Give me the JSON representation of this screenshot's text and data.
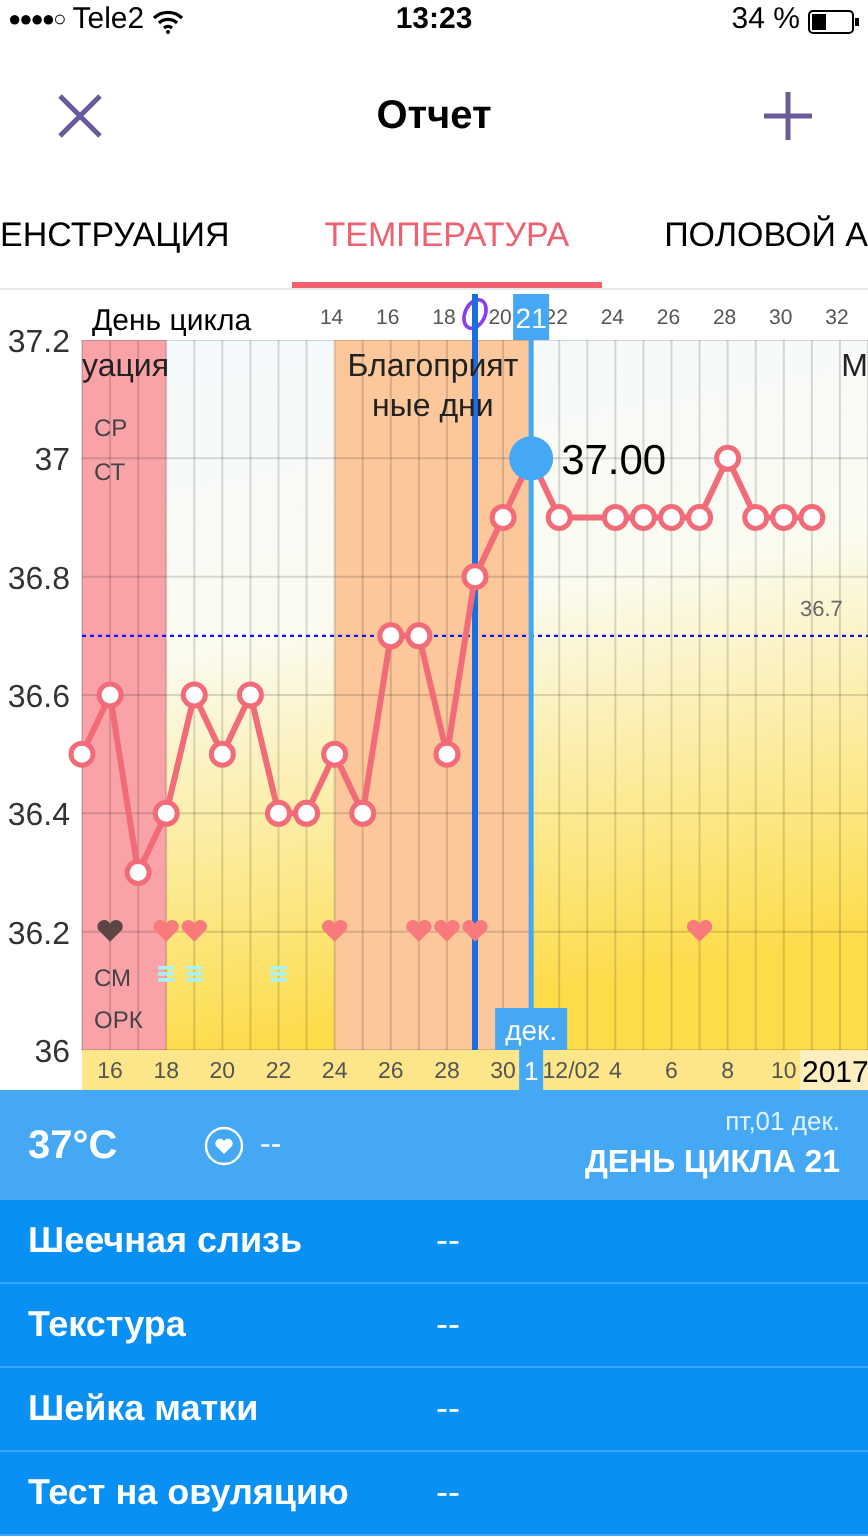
{
  "status_bar": {
    "signal": "●●●●○",
    "carrier": "Tele2",
    "time": "13:23",
    "battery": "34 %"
  },
  "nav": {
    "title": "Отчет"
  },
  "tabs": [
    {
      "label": "ЕНСТРУАЦИЯ",
      "selected": false
    },
    {
      "label": "ТЕМПЕРАТУРА",
      "selected": true
    },
    {
      "label": "ПОЛОВОЙ А",
      "selected": false
    }
  ],
  "chart": {
    "cycle_axis_title": "День цикла",
    "cycle_tag": "21",
    "row_labels": [
      "СР",
      "СТ",
      "СМ",
      "ОРК"
    ],
    "edge_label": "М",
    "day_marks": [
      {
        "kind": "empty"
      },
      {
        "kind": "heart",
        "color": "#5b4545"
      },
      {
        "kind": "empty"
      },
      {
        "kind": "heart_note",
        "color": "#f87a7a"
      },
      {
        "kind": "heart_note",
        "color": "#f87a7a"
      },
      {
        "kind": "empty"
      },
      {
        "kind": "empty"
      },
      {
        "kind": "note"
      },
      {
        "kind": "empty"
      },
      {
        "kind": "heart",
        "color": "#f87a7a"
      },
      {
        "kind": "empty"
      },
      {
        "kind": "empty"
      },
      {
        "kind": "heart",
        "color": "#f87a7a"
      },
      {
        "kind": "heart",
        "color": "#f87a7a"
      },
      {
        "kind": "heart",
        "color": "#f87a7a"
      },
      {
        "kind": "empty"
      },
      {
        "kind": "empty"
      },
      {
        "kind": "empty"
      },
      {
        "kind": "empty"
      },
      {
        "kind": "empty"
      },
      {
        "kind": "empty"
      },
      {
        "kind": "empty"
      },
      {
        "kind": "heart",
        "color": "#f87a7a"
      }
    ],
    "date_axis": {
      "labels": [
        "16",
        "18",
        "20",
        "22",
        "24",
        "26",
        "28",
        "30",
        "12/02",
        "4",
        "6",
        "8",
        "10"
      ],
      "month_tag": "дек.",
      "day_tag": "1",
      "year": "2017"
    },
    "chart_data": {
      "type": "line",
      "x": [
        5,
        6,
        7,
        8,
        9,
        10,
        11,
        12,
        13,
        14,
        15,
        16,
        17,
        18,
        19,
        20,
        21,
        22,
        23,
        24,
        25,
        26,
        27,
        28,
        29,
        30,
        31
      ],
      "series": [
        {
          "color": "#f26b78",
          "marker": "circle",
          "values": [
            36.5,
            36.6,
            36.3,
            36.4,
            36.6,
            36.5,
            36.6,
            36.4,
            36.4,
            36.5,
            36.4,
            36.7,
            36.7,
            36.5,
            36.8,
            36.9,
            37.0,
            36.9,
            null,
            36.9,
            36.9,
            36.9,
            36.9,
            37.0,
            36.9,
            36.9,
            36.9
          ]
        }
      ],
      "xlim": [
        5,
        33
      ],
      "ylim": [
        36,
        37.2
      ],
      "yticks": [
        36,
        36.2,
        36.4,
        36.6,
        36.8,
        37,
        37.2
      ],
      "xticks": [
        14,
        16,
        18,
        20,
        22,
        24,
        26,
        28,
        30,
        32
      ],
      "grid": true,
      "bands": [
        {
          "axis": "x",
          "from": 5,
          "to": 8,
          "label": "уация",
          "color": "#f9a3a8"
        },
        {
          "axis": "x",
          "from": 14,
          "to": 21,
          "label": "Благоприятные дни",
          "color": "#fcc79a"
        }
      ],
      "ref_lines": [
        {
          "axis": "y",
          "value": 36.7,
          "label": "36.7",
          "color": "#1010ff"
        },
        {
          "axis": "x",
          "value": 19,
          "color": "#1a6fe0"
        },
        {
          "axis": "x",
          "value": 21,
          "color": "#45a8f4"
        }
      ],
      "annotations": [
        {
          "x": 21,
          "y": 37.0,
          "text": "37.00"
        }
      ]
    }
  },
  "summary": {
    "temperature": "37°C",
    "intercourse": "--",
    "date": "пт,01 дек.",
    "cycle_day": "ДЕНЬ ЦИКЛА 21"
  },
  "rows": [
    {
      "label": "Шеечная слизь",
      "value": "--"
    },
    {
      "label": "Текстура",
      "value": "--"
    },
    {
      "label": "Шейка матки",
      "value": "--"
    },
    {
      "label": "Тест на овуляцию",
      "value": "--"
    }
  ]
}
